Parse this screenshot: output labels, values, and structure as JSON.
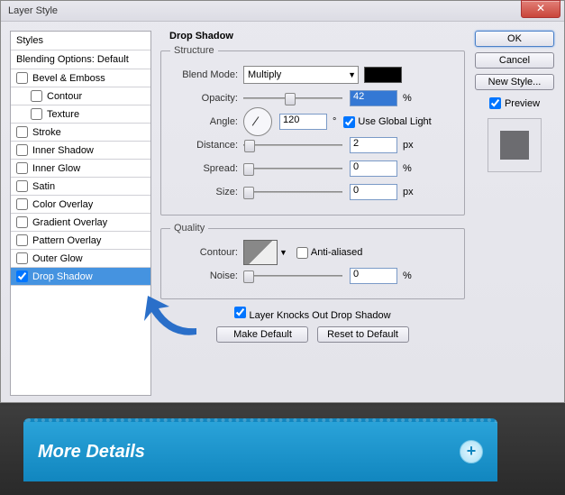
{
  "window": {
    "title": "Layer Style"
  },
  "styles": {
    "header": "Styles",
    "sub": "Blending Options: Default",
    "items": [
      {
        "label": "Bevel & Emboss",
        "checked": false,
        "indent": false
      },
      {
        "label": "Contour",
        "checked": false,
        "indent": true
      },
      {
        "label": "Texture",
        "checked": false,
        "indent": true
      },
      {
        "label": "Stroke",
        "checked": false,
        "indent": false
      },
      {
        "label": "Inner Shadow",
        "checked": false,
        "indent": false
      },
      {
        "label": "Inner Glow",
        "checked": false,
        "indent": false
      },
      {
        "label": "Satin",
        "checked": false,
        "indent": false
      },
      {
        "label": "Color Overlay",
        "checked": false,
        "indent": false
      },
      {
        "label": "Gradient Overlay",
        "checked": false,
        "indent": false
      },
      {
        "label": "Pattern Overlay",
        "checked": false,
        "indent": false
      },
      {
        "label": "Outer Glow",
        "checked": false,
        "indent": false
      },
      {
        "label": "Drop Shadow",
        "checked": true,
        "indent": false,
        "selected": true
      }
    ]
  },
  "panel": {
    "title": "Drop Shadow",
    "structure": {
      "legend": "Structure",
      "blend_mode_label": "Blend Mode:",
      "blend_mode_value": "Multiply",
      "opacity_label": "Opacity:",
      "opacity_value": "42",
      "opacity_unit": "%",
      "angle_label": "Angle:",
      "angle_value": "120",
      "angle_unit": "°",
      "use_global": "Use Global Light",
      "distance_label": "Distance:",
      "distance_value": "2",
      "distance_unit": "px",
      "spread_label": "Spread:",
      "spread_value": "0",
      "spread_unit": "%",
      "size_label": "Size:",
      "size_value": "0",
      "size_unit": "px"
    },
    "quality": {
      "legend": "Quality",
      "contour_label": "Contour:",
      "anti": "Anti-aliased",
      "noise_label": "Noise:",
      "noise_value": "0",
      "noise_unit": "%"
    },
    "knock": "Layer Knocks Out Drop Shadow",
    "make_default": "Make Default",
    "reset": "Reset to Default"
  },
  "right": {
    "ok": "OK",
    "cancel": "Cancel",
    "new_style": "New Style...",
    "preview": "Preview"
  },
  "banner": {
    "text": "More Details"
  }
}
